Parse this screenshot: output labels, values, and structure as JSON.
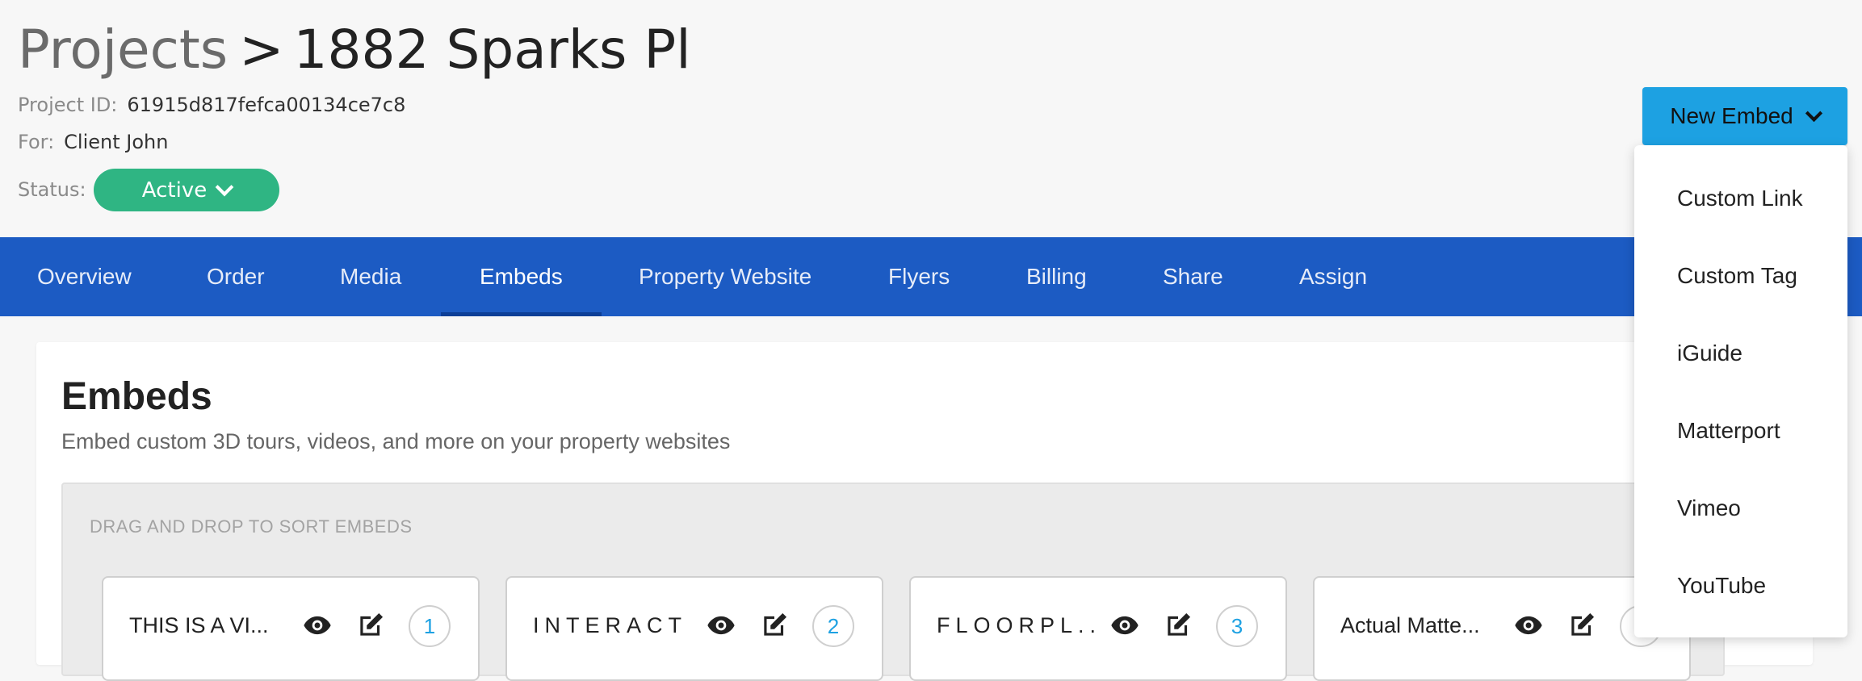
{
  "breadcrumb": {
    "root": "Projects",
    "separator": ">",
    "current": "1882 Sparks Pl"
  },
  "project": {
    "id_label": "Project ID:",
    "id_value": "61915d817fefca00134ce7c8",
    "for_label": "For:",
    "for_value": "Client John",
    "status_label": "Status:",
    "status_value": "Active",
    "status_color": "#2fb583"
  },
  "new_embed": {
    "label": "New Embed",
    "color": "#1da1e2"
  },
  "tabs": [
    {
      "label": "Overview"
    },
    {
      "label": "Order"
    },
    {
      "label": "Media"
    },
    {
      "label": "Embeds",
      "active": true
    },
    {
      "label": "Property Website"
    },
    {
      "label": "Flyers"
    },
    {
      "label": "Billing"
    },
    {
      "label": "Share"
    },
    {
      "label": "Assign"
    }
  ],
  "tab_bar_color": "#1c5bc3",
  "embeds_section": {
    "title": "Embeds",
    "subtitle": "Embed custom 3D tours, videos, and more on your property websites",
    "sort_label": "DRAG AND DROP TO SORT EMBEDS",
    "items": [
      {
        "name": "THIS IS A VI...",
        "index": "1"
      },
      {
        "name": "INTERACT",
        "index": "2"
      },
      {
        "name": "FLOORPL...",
        "index": "3"
      },
      {
        "name": "Actual Matte...",
        "index": ""
      }
    ]
  },
  "dropdown_menu": {
    "items": [
      "Custom Link",
      "Custom Tag",
      "iGuide",
      "Matterport",
      "Vimeo",
      "YouTube"
    ]
  },
  "icons": {
    "view": "eye-icon",
    "edit": "edit-icon",
    "caret": "chevron-down-icon"
  }
}
